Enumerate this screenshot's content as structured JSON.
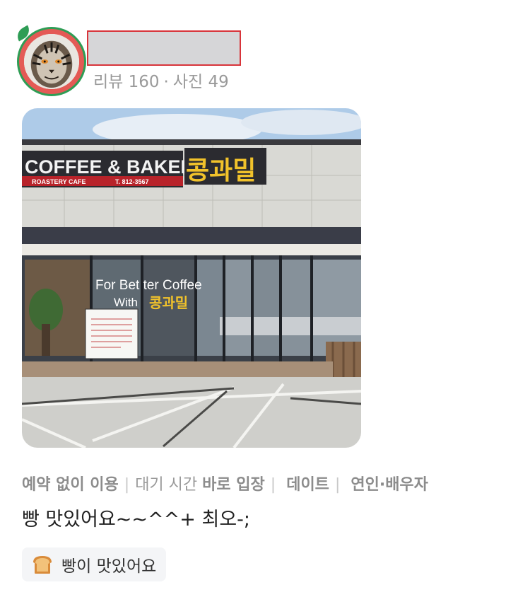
{
  "reviewer": {
    "avatar_icon": "tiger-avatar-icon",
    "stats": {
      "reviews": "리뷰 160",
      "separator": "·",
      "photos": "사진 49"
    }
  },
  "photo": {
    "sign_main": "COFFEE & BAKERY",
    "sign_sub": "ROASTERY CAFE",
    "sign_phone": "T. 812-3567",
    "sign_brand": "콩과밀",
    "window_line1": "For  Bet ter Coffee",
    "window_line2": "With",
    "window_brand": "콩과밀"
  },
  "tags": {
    "t1": "예약 없이 이용",
    "t2_label": "대기 시간",
    "t2_value": "바로 입장",
    "t3": "데이트",
    "t4": "연인·배우자",
    "divider": "|"
  },
  "review_text": "빵 맛있어요~~^^+ 최오-;",
  "keyword_chip": {
    "icon": "bread-icon",
    "label": "빵이 맛있어요"
  }
}
